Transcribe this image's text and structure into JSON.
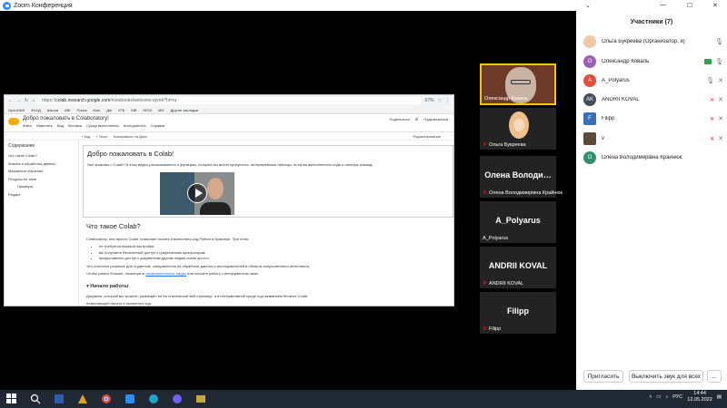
{
  "window": {
    "title": "Zoom Конференция"
  },
  "browser": {
    "url_host": "colab.research.google.com",
    "url_prefix": "https://",
    "url_path": "/notebooks/welcome.ipynb?hl=ru",
    "zoom": "67%",
    "bookmarks": [
      "OpenHAB",
      "ЗНАД",
      "Школа",
      "ABI",
      "Поиск",
      "Кіно",
      "Дія",
      "УГБ",
      "МВ",
      "HEGI",
      "MG",
      "Другие закладки"
    ]
  },
  "colab": {
    "title": "Добро пожаловать в Colaboratory!",
    "menu": [
      "Файл",
      "Изменить",
      "Вид",
      "Вставка",
      "Среда выполнения",
      "Инструменты",
      "Справка"
    ],
    "share": "Поделиться",
    "connect": "Подключиться",
    "toolbar": [
      "+ Код",
      "+ Текст",
      "Копировать на Диск"
    ],
    "edit_mode": "Редактирование",
    "sidebar": {
      "title": "Содержание",
      "items": [
        "Что такое Colab?",
        "Анализ и обработка данных",
        "Машинное обучение",
        "Ресурсы по теме",
        "Примеры",
        "Раздел"
      ]
    },
    "cell1": {
      "heading": "Добро пожаловать в Colab!",
      "text": "Уже знакомы с Colab? В этом видео рассказывается о функциях, которые вы могли пропустить: интерактивные таблицы, история выполненного кода и палитре команд."
    },
    "cell2": {
      "heading": "Что такое Colab?",
      "intro": "Colaboratory, или просто Colab, позволяет писать и выполнять код Python в браузере. При этом:",
      "bullets": [
        "не требуется никакой настройки;",
        "вы получаете бесплатный доступ к графическим процессорам;",
        "предоставлять доступ к документам другим людям очень просто."
      ],
      "line1": "Это отличное решение для студентов, специалистов по обработке данных и исследователей в области искусственного интеллекта.",
      "line2_start": "Чтобы узнать больше, посмотрите ",
      "line2_link": "ознакомительное видео",
      "line2_end": " или начните работу с инструментом ниже.",
      "subheading": "Начало работы",
      "p1": "Документ, который вы читаете, размещён не на статической веб-странице, а в интерактивной среде под названием блокнот Colab,",
      "p2": "позволяющей писать и выполнять код."
    }
  },
  "tiles": [
    {
      "name": "Олександр Коваль",
      "muted": false
    },
    {
      "name": "Ольга Букреева",
      "muted": true
    },
    {
      "name": "Олена Володимирівна Крайнюк",
      "big": "Олена Володи…",
      "muted": true
    },
    {
      "name": "A_Polyarus",
      "big": "A_Polyarus",
      "muted": false
    },
    {
      "name": "ANDRII KOVAL",
      "big": "ANDRII KOVAL",
      "muted": true
    },
    {
      "name": "Filipp",
      "big": "Filipp",
      "muted": true
    }
  ],
  "participants": {
    "title": "Участники (7)",
    "list": [
      {
        "name": "Ольга Букреева (Организатор, я)",
        "initials": "",
        "color": "#f2c7a5"
      },
      {
        "name": "Олександр Коваль",
        "initials": "О",
        "color": "#9b5fb3"
      },
      {
        "name": "A_Polyarus",
        "initials": "A",
        "color": "#e54c3c"
      },
      {
        "name": "ANDRII KOVAL",
        "initials": "AK",
        "color": "#444c5a"
      },
      {
        "name": "Filipp",
        "initials": "F",
        "color": "#3b6fb5"
      },
      {
        "name": "v",
        "initials": "",
        "color": "#5a4a3a"
      },
      {
        "name": "Олена Володимирівна Крайнюк",
        "initials": "О",
        "color": "#2f8f6f"
      }
    ],
    "invite": "Пригласить",
    "mute_all": "Выключить звук для всех",
    "more": "..."
  },
  "taskbar": {
    "lang": "РУС",
    "time": "14:44",
    "date": "12.05.2022"
  },
  "colors": {
    "accent": "#2d8cff",
    "taskbar": "#1f2833",
    "highlight": "#f4c500",
    "muted": "#e02828"
  }
}
